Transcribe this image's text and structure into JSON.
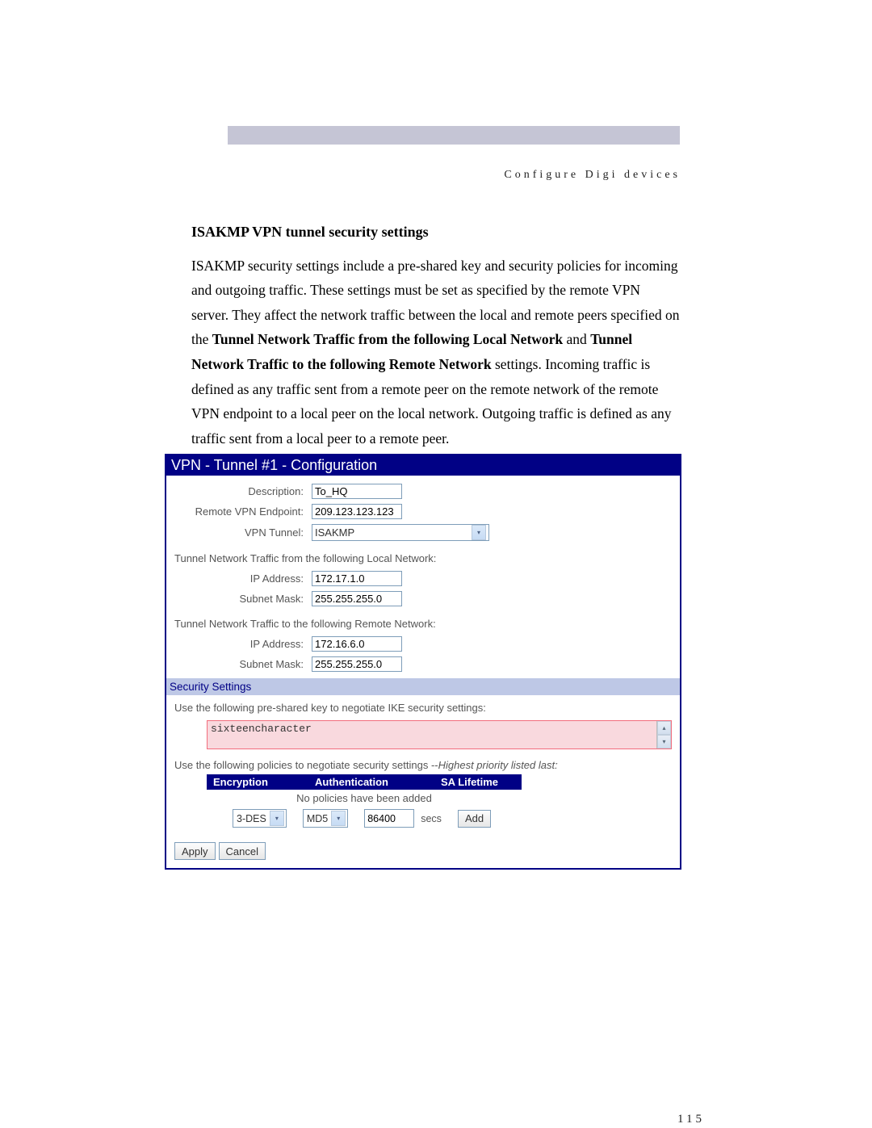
{
  "header": {
    "section": "Configure Digi devices"
  },
  "body": {
    "heading": "ISAKMP VPN tunnel security settings",
    "para_pre": "ISAKMP security settings include a pre-shared key and security policies for incoming and outgoing traffic. These settings must be set as specified by the remote VPN server. They affect the network traffic between the local and remote peers specified on the ",
    "bold1": "Tunnel Network Traffic from the following Local Network",
    "mid1": " and ",
    "bold2": "Tunnel Network Traffic to the following Remote Network",
    "para_post": " settings. Incoming traffic is defined as any traffic sent from a remote peer on the remote network of the remote VPN endpoint to a local peer on the local network. Outgoing traffic is defined as any traffic sent from a local peer to a remote peer."
  },
  "panel": {
    "title": "VPN - Tunnel #1 - Configuration",
    "fields": {
      "description_label": "Description:",
      "description_value": "To_HQ",
      "endpoint_label": "Remote VPN Endpoint:",
      "endpoint_value": "209.123.123.123",
      "tunnel_label": "VPN Tunnel:",
      "tunnel_value": "ISAKMP"
    },
    "local_section": "Tunnel Network Traffic from the following Local Network:",
    "local": {
      "ip_label": "IP Address:",
      "ip_value": "172.17.1.0",
      "mask_label": "Subnet Mask:",
      "mask_value": "255.255.255.0"
    },
    "remote_section": "Tunnel Network Traffic to the following Remote Network:",
    "remote": {
      "ip_label": "IP Address:",
      "ip_value": "172.16.6.0",
      "mask_label": "Subnet Mask:",
      "mask_value": "255.255.255.0"
    },
    "security_header": "Security Settings",
    "preshared_label": "Use the following pre-shared key to negotiate IKE security settings:",
    "preshared_value": "sixteencharacter",
    "policies_label_pre": "Use the following policies to negotiate security settings --",
    "policies_label_italic": "Highest priority listed last:",
    "policy_headers": {
      "encryption": "Encryption",
      "authentication": "Authentication",
      "sa_lifetime": "SA Lifetime"
    },
    "policy_empty": "No policies have been added",
    "policy_controls": {
      "encryption": "3-DES",
      "authentication": "MD5",
      "lifetime": "86400",
      "unit": "secs",
      "add": "Add"
    },
    "buttons": {
      "apply": "Apply",
      "cancel": "Cancel"
    }
  },
  "page_number": "115"
}
